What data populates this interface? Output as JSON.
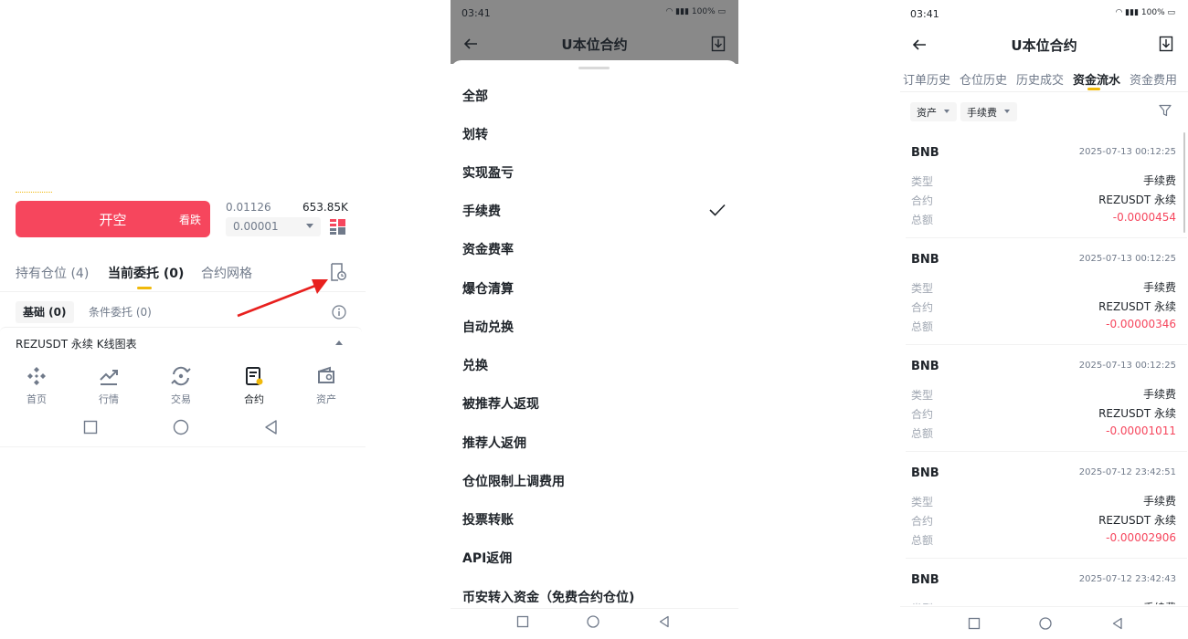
{
  "panel1": {
    "short_button": {
      "label": "开空",
      "sub_label": "看跌"
    },
    "orderbook": {
      "price": "0.01126",
      "amount": "653.85K",
      "precision": "0.00001"
    },
    "tabs": [
      {
        "label": "持有仓位 (4)"
      },
      {
        "label": "当前委托 (0)"
      },
      {
        "label": "合约网格"
      }
    ],
    "subtabs": [
      {
        "label": "基础 (0)"
      },
      {
        "label": "条件委托 (0)"
      }
    ],
    "symbol_row": {
      "label": "REZUSDT 永续 K线图表"
    },
    "bottom_nav": [
      {
        "label": "首页",
        "icon": "home-icon"
      },
      {
        "label": "行情",
        "icon": "markets-icon"
      },
      {
        "label": "交易",
        "icon": "trade-icon"
      },
      {
        "label": "合约",
        "icon": "futures-icon"
      },
      {
        "label": "资产",
        "icon": "wallet-icon"
      }
    ],
    "annotation_arrow_color": "#e8201e"
  },
  "panel2": {
    "status_time": "03:41",
    "status_right": "100%",
    "title": "U本位合约",
    "options": [
      {
        "label": "全部"
      },
      {
        "label": "划转"
      },
      {
        "label": "实现盈亏"
      },
      {
        "label": "手续费",
        "selected": true
      },
      {
        "label": "资金费率"
      },
      {
        "label": "爆仓清算"
      },
      {
        "label": "自动兑换"
      },
      {
        "label": "兑换"
      },
      {
        "label": "被推荐人返现"
      },
      {
        "label": "推荐人返佣"
      },
      {
        "label": "仓位限制上调费用"
      },
      {
        "label": "投票转账"
      },
      {
        "label": "API返佣"
      },
      {
        "label": "币安转入资金（免费合约仓位)"
      }
    ]
  },
  "panel3": {
    "status_time": "03:41",
    "status_right": "100%",
    "title": "U本位合约",
    "tabs": [
      {
        "label": "订单历史"
      },
      {
        "label": "仓位历史"
      },
      {
        "label": "历史成交"
      },
      {
        "label": "资金流水"
      },
      {
        "label": "资金费用"
      }
    ],
    "filters": [
      {
        "label": "资产"
      },
      {
        "label": "手续费"
      }
    ],
    "field_labels": {
      "type": "类型",
      "contract": "合约",
      "amount": "总额"
    },
    "records": [
      {
        "asset": "BNB",
        "time": "2025-07-13 00:12:25",
        "type": "手续费",
        "contract": "REZUSDT 永续",
        "amount": "-0.0000454"
      },
      {
        "asset": "BNB",
        "time": "2025-07-13 00:12:25",
        "type": "手续费",
        "contract": "REZUSDT 永续",
        "amount": "-0.00000346"
      },
      {
        "asset": "BNB",
        "time": "2025-07-13 00:12:25",
        "type": "手续费",
        "contract": "REZUSDT 永续",
        "amount": "-0.00001011"
      },
      {
        "asset": "BNB",
        "time": "2025-07-12 23:42:51",
        "type": "手续费",
        "contract": "REZUSDT 永续",
        "amount": "-0.00002906"
      },
      {
        "asset": "BNB",
        "time": "2025-07-12 23:42:43",
        "type": "手续费",
        "contract": "",
        "amount": ""
      }
    ]
  },
  "colors": {
    "accent": "#f0b90b",
    "sell": "#f6465d",
    "text": "#1e2329",
    "muted": "#707a8a"
  }
}
